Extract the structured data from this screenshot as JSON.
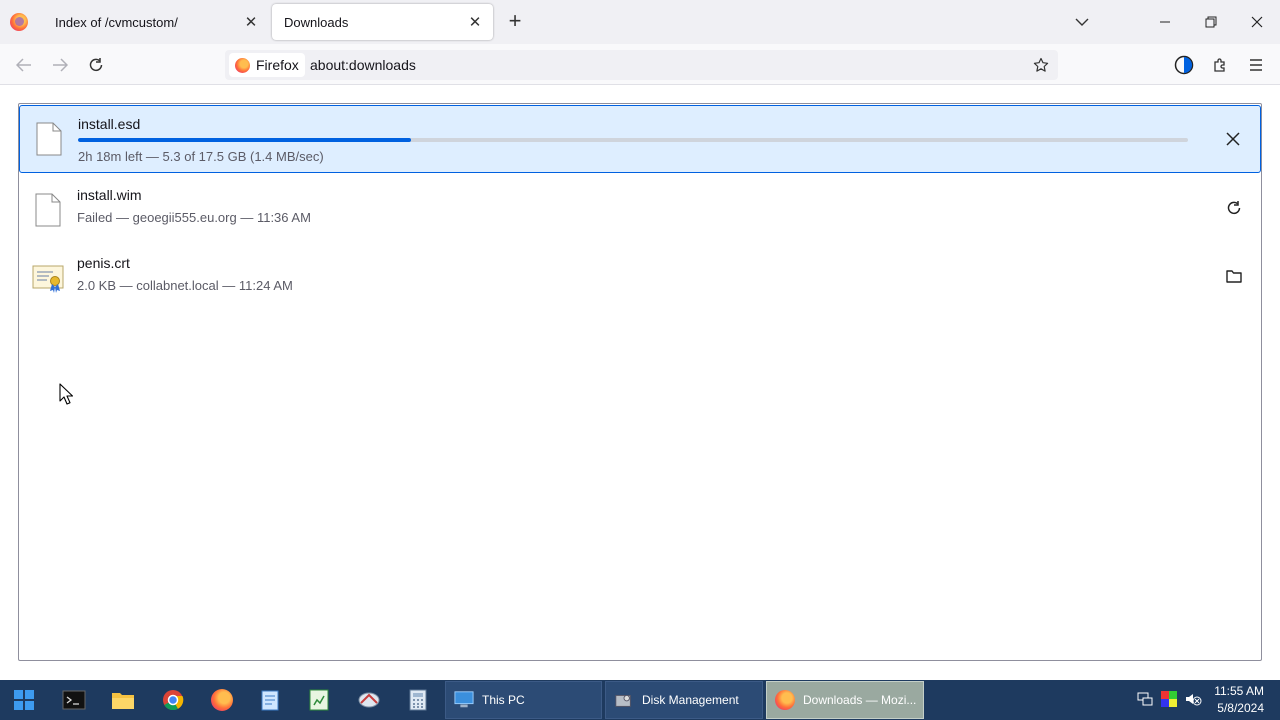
{
  "tabs": [
    {
      "title": "Index of /cvmcustom/",
      "close": "✕"
    },
    {
      "title": "Downloads",
      "close": "✕"
    }
  ],
  "new_tab": "+",
  "url_bar": {
    "identity_label": "Firefox",
    "url": "about:downloads"
  },
  "downloads": [
    {
      "name": "install.esd",
      "status": "2h 18m left — 5.3 of 17.5 GB (1.4 MB/sec)",
      "progress": 0.3,
      "action_icon": "close-icon"
    },
    {
      "name": "install.wim",
      "status": "Failed — geoegii555.eu.org — 11:36 AM",
      "action_icon": "retry-icon"
    },
    {
      "name": "penis.crt",
      "status": "2.0 KB — collabnet.local — 11:24 AM",
      "action_icon": "folder-icon"
    }
  ],
  "taskbar": {
    "apps": [
      {
        "label": "This PC"
      },
      {
        "label": "Disk Management"
      },
      {
        "label": "Downloads — Mozi..."
      }
    ],
    "time": "11:55 AM",
    "date": "5/8/2024"
  },
  "colors": {
    "accent": "#0061e0",
    "selected_row": "#deeeff",
    "taskbar": "#1e3a5f"
  }
}
